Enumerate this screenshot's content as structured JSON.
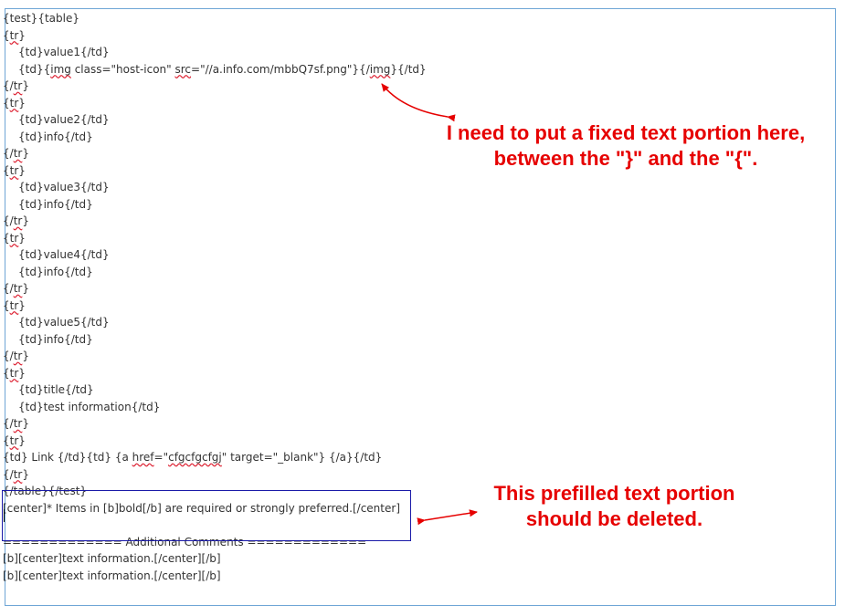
{
  "editor": {
    "lines": [
      {
        "text": "{test}{table}",
        "indent": false
      },
      {
        "text": "{tr}",
        "indent": false,
        "spell": true
      },
      {
        "text": "{td}value1{/td}",
        "indent": true
      },
      {
        "text": "{td}{img class=\"host-icon\" src=\"//a.info.com/mbbQ7sf.png\"}{/img}{/td}",
        "indent": true
      },
      {
        "text": "{/tr}",
        "indent": false,
        "spell": true
      },
      {
        "text": "{tr}",
        "indent": false,
        "spell": true
      },
      {
        "text": "{td}value2{/td}",
        "indent": true
      },
      {
        "text": "{td}info{/td}",
        "indent": true
      },
      {
        "text": "{/tr}",
        "indent": false,
        "spell": true
      },
      {
        "text": "{tr}",
        "indent": false,
        "spell": true
      },
      {
        "text": "{td}value3{/td}",
        "indent": true
      },
      {
        "text": "{td}info{/td}",
        "indent": true
      },
      {
        "text": "{/tr}",
        "indent": false,
        "spell": true
      },
      {
        "text": "{tr}",
        "indent": false,
        "spell": true
      },
      {
        "text": "{td}value4{/td}",
        "indent": true
      },
      {
        "text": "{td}info{/td}",
        "indent": true
      },
      {
        "text": "{/tr}",
        "indent": false,
        "spell": true
      },
      {
        "text": "{tr}",
        "indent": false,
        "spell": true
      },
      {
        "text": "{td}value5{/td}",
        "indent": true
      },
      {
        "text": "{td}info{/td}",
        "indent": true
      },
      {
        "text": "{/tr}",
        "indent": false,
        "spell": true
      },
      {
        "text": "{tr}",
        "indent": false,
        "spell": true
      },
      {
        "text": "{td}title{/td}",
        "indent": true
      },
      {
        "text": "{td}test information{/td}",
        "indent": true
      },
      {
        "text": "{/tr}",
        "indent": false,
        "spell": true
      },
      {
        "text": "{tr}",
        "indent": false,
        "spell": true
      },
      {
        "text": "{td} Link {/td}{td} {a href=\"cfgcfgcfgj\" target=\"_blank\"} {/a}{/td}",
        "indent": false
      },
      {
        "text": "{/tr}",
        "indent": false,
        "spell": true
      },
      {
        "text": "{/table}{/test}",
        "indent": false
      },
      {
        "text": "[center]* Items in [b]bold[/b] are required or strongly preferred.[/center]",
        "indent": false
      },
      {
        "text": "",
        "indent": false
      },
      {
        "text": "============= Additional Comments =============",
        "indent": false
      },
      {
        "text": "[b][center]text information.[/center][/b]",
        "indent": false
      },
      {
        "text": "[b][center]text information.[/center][/b]",
        "indent": false
      }
    ]
  },
  "annotations": {
    "top_note": "I need to put a fixed text portion here,\nbetween the \"}\" and the \"{\".",
    "bottom_note": "This prefilled text portion\nshould be deleted.",
    "color": "#e60000"
  }
}
